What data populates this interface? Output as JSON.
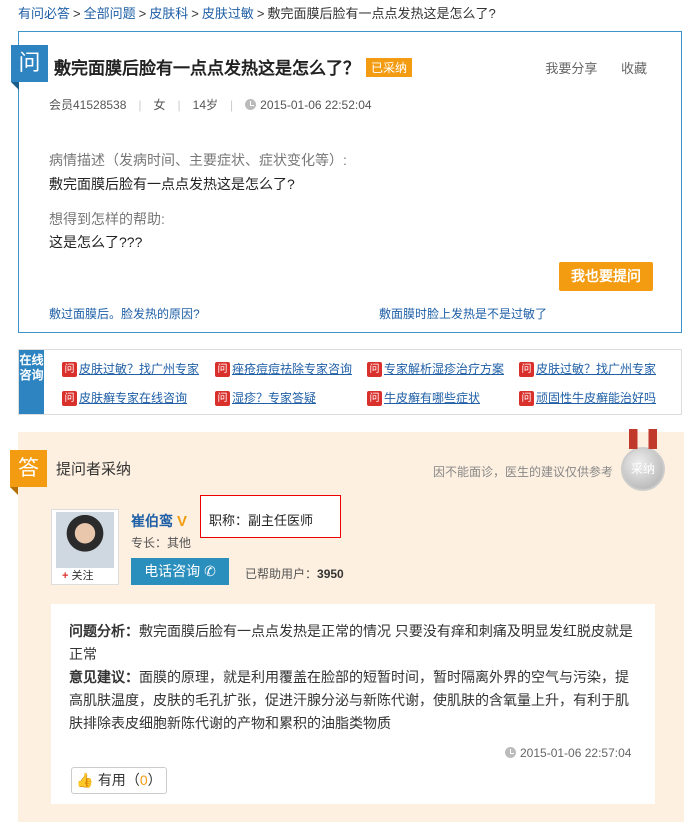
{
  "breadcrumb": [
    "有问必答",
    "全部问题",
    "皮肤科",
    "皮肤过敏",
    "敷完面膜后脸有一点点发热这是怎么了?"
  ],
  "question": {
    "badge": "问",
    "title": "敷完面膜后脸有一点点发热这是怎么了？",
    "status": "已采纳",
    "share": "我要分享",
    "favorite": "收藏",
    "member": "会员41528538",
    "gender": "女",
    "age": "14岁",
    "time": "2015-01-06 22:52:04",
    "desc_label": "病情描述（发病时间、主要症状、症状变化等）:",
    "desc": "敷完面膜后脸有一点点发热这是怎么了?",
    "help_label": "想得到怎样的帮助:",
    "help": "这是怎么了???",
    "ask_button": "我也要提问",
    "related": [
      "敷过面膜后。脸发热的原因?",
      "敷面膜时脸上发热是不是过敏了"
    ]
  },
  "consult": {
    "tag": "在线咨询",
    "icon_char": "问",
    "items": [
      "皮肤过敏？找广州专家",
      "痤疮痘痘祛除专家咨询",
      "专家解析湿疹治疗方案",
      "皮肤过敏？找广州专家",
      "皮肤癣专家在线咨询",
      "湿疹？专家答疑",
      "牛皮癣有哪些症状",
      "顽固性牛皮癣能治好吗"
    ]
  },
  "answer": {
    "badge": "答",
    "title": "提问者采纳",
    "note": "因不能面诊，医生的建议仅供参考",
    "medal": "采纳",
    "doctor_name": "崔伯鸾",
    "vmark": "V",
    "doctor_title": "职称：副主任医师",
    "specialty": "专长：其他",
    "follow": "关注",
    "follow_plus": "+",
    "phone_button": "电话咨询",
    "helped_label": "已帮助用户：",
    "helped_count": "3950",
    "analysis_label": "问题分析：",
    "analysis": "敷完面膜后脸有一点点发热是正常的情况 只要没有痒和刺痛及明显发红脱皮就是正常",
    "advice_label": "意见建议：",
    "advice": "面膜的原理，就是利用覆盖在脸部的短暂时间，暂时隔离外界的空气与污染，提高肌肤温度，皮肤的毛孔扩张，促进汗腺分泌与新陈代谢，使肌肤的含氧量上升，有利于肌肤排除表皮细胞新陈代谢的产物和累积的油脂类物质",
    "time": "2015-01-06 22:57:04",
    "useful_label": "有用",
    "useful_count": "0"
  }
}
